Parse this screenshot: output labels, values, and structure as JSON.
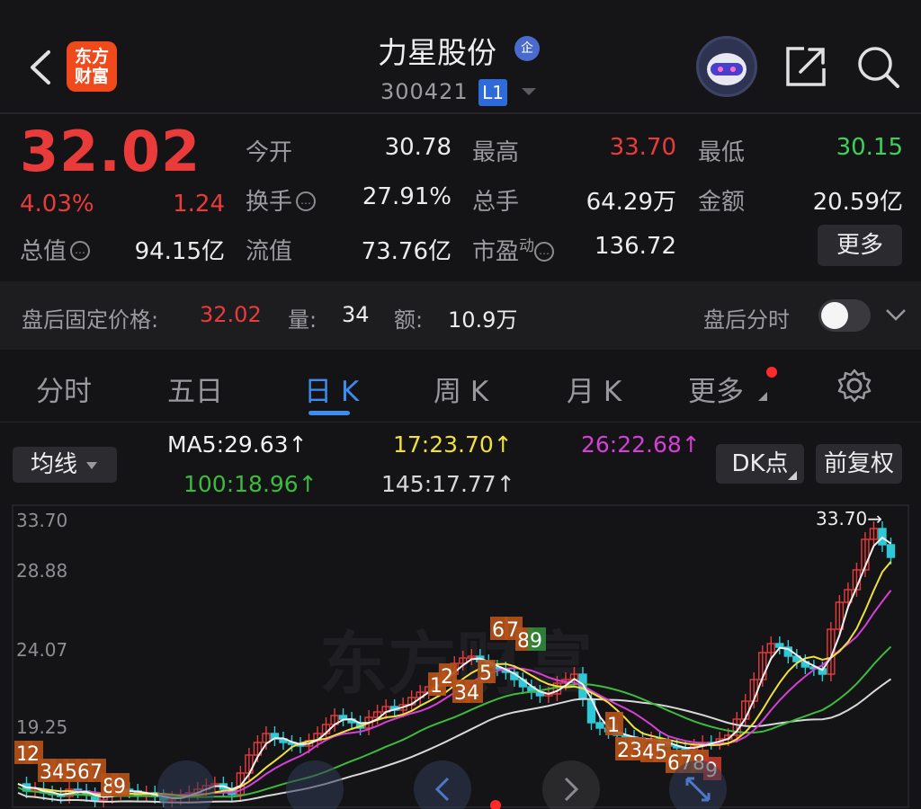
{
  "header": {
    "logo_text": "东方财富",
    "stock_name": "力星股份",
    "badge": "企",
    "code": "300421",
    "level": "L1",
    "icons": [
      "back-arrow-icon",
      "share-icon",
      "search-icon",
      "chevron-down-icon"
    ]
  },
  "quote": {
    "price": "32.02",
    "change_pct": "4.03%",
    "change": "1.24",
    "open_label": "今开",
    "open": "30.78",
    "high_label": "最高",
    "high": "33.70",
    "low_label": "最低",
    "low": "30.15",
    "turnover_label": "换手",
    "turnover": "27.91%",
    "volume_label": "总手",
    "volume": "64.29万",
    "amount_label": "金额",
    "amount": "20.59亿",
    "mktcap_label": "总值",
    "mktcap": "94.15亿",
    "float_label": "流值",
    "float_cap": "73.76亿",
    "pe_label": "市盈",
    "pe_sup": "动",
    "pe": "136.72",
    "more_label": "更多"
  },
  "after_hours": {
    "price_label": "盘后固定价格:",
    "price": "32.02",
    "vol_label": "量:",
    "vol": "34",
    "amt_label": "额:",
    "amt": "10.9万",
    "timeshare_label": "盘后分时"
  },
  "tabs": [
    {
      "label": "分时"
    },
    {
      "label": "五日"
    },
    {
      "label": "日 K"
    },
    {
      "label": "周 K"
    },
    {
      "label": "月 K"
    },
    {
      "label": "更多"
    }
  ],
  "ma": {
    "dropdown_label": "均线",
    "ma5": "MA5:29.63↑",
    "ma17": "17:23.70↑",
    "ma26": "26:22.68↑",
    "ma100": "100:18.96↑",
    "ma145": "145:17.77↑",
    "dk_label": "DK点",
    "fq_label": "前复权",
    "colors": {
      "ma5": "#f2f2f2",
      "ma17": "#f0e03a",
      "ma26": "#d63fd6",
      "ma100": "#3dbb3d",
      "ma145": "#d8d8d8"
    }
  },
  "chart_data": {
    "type": "candlestick",
    "y_ticks": [
      "33.70",
      "28.88",
      "24.07",
      "19.25"
    ],
    "high_marker": "33.70→",
    "watermark": "东方财富",
    "up_color": "#ea3b3b",
    "down_color": "#2ec9d6",
    "td_labels_top": [
      "1",
      "2",
      "3",
      "4",
      "5",
      "6",
      "7",
      "8",
      "9"
    ],
    "td_labels_bottom": [
      "1",
      "2",
      "3",
      "4",
      "5",
      "6",
      "7",
      "8",
      "9"
    ]
  }
}
